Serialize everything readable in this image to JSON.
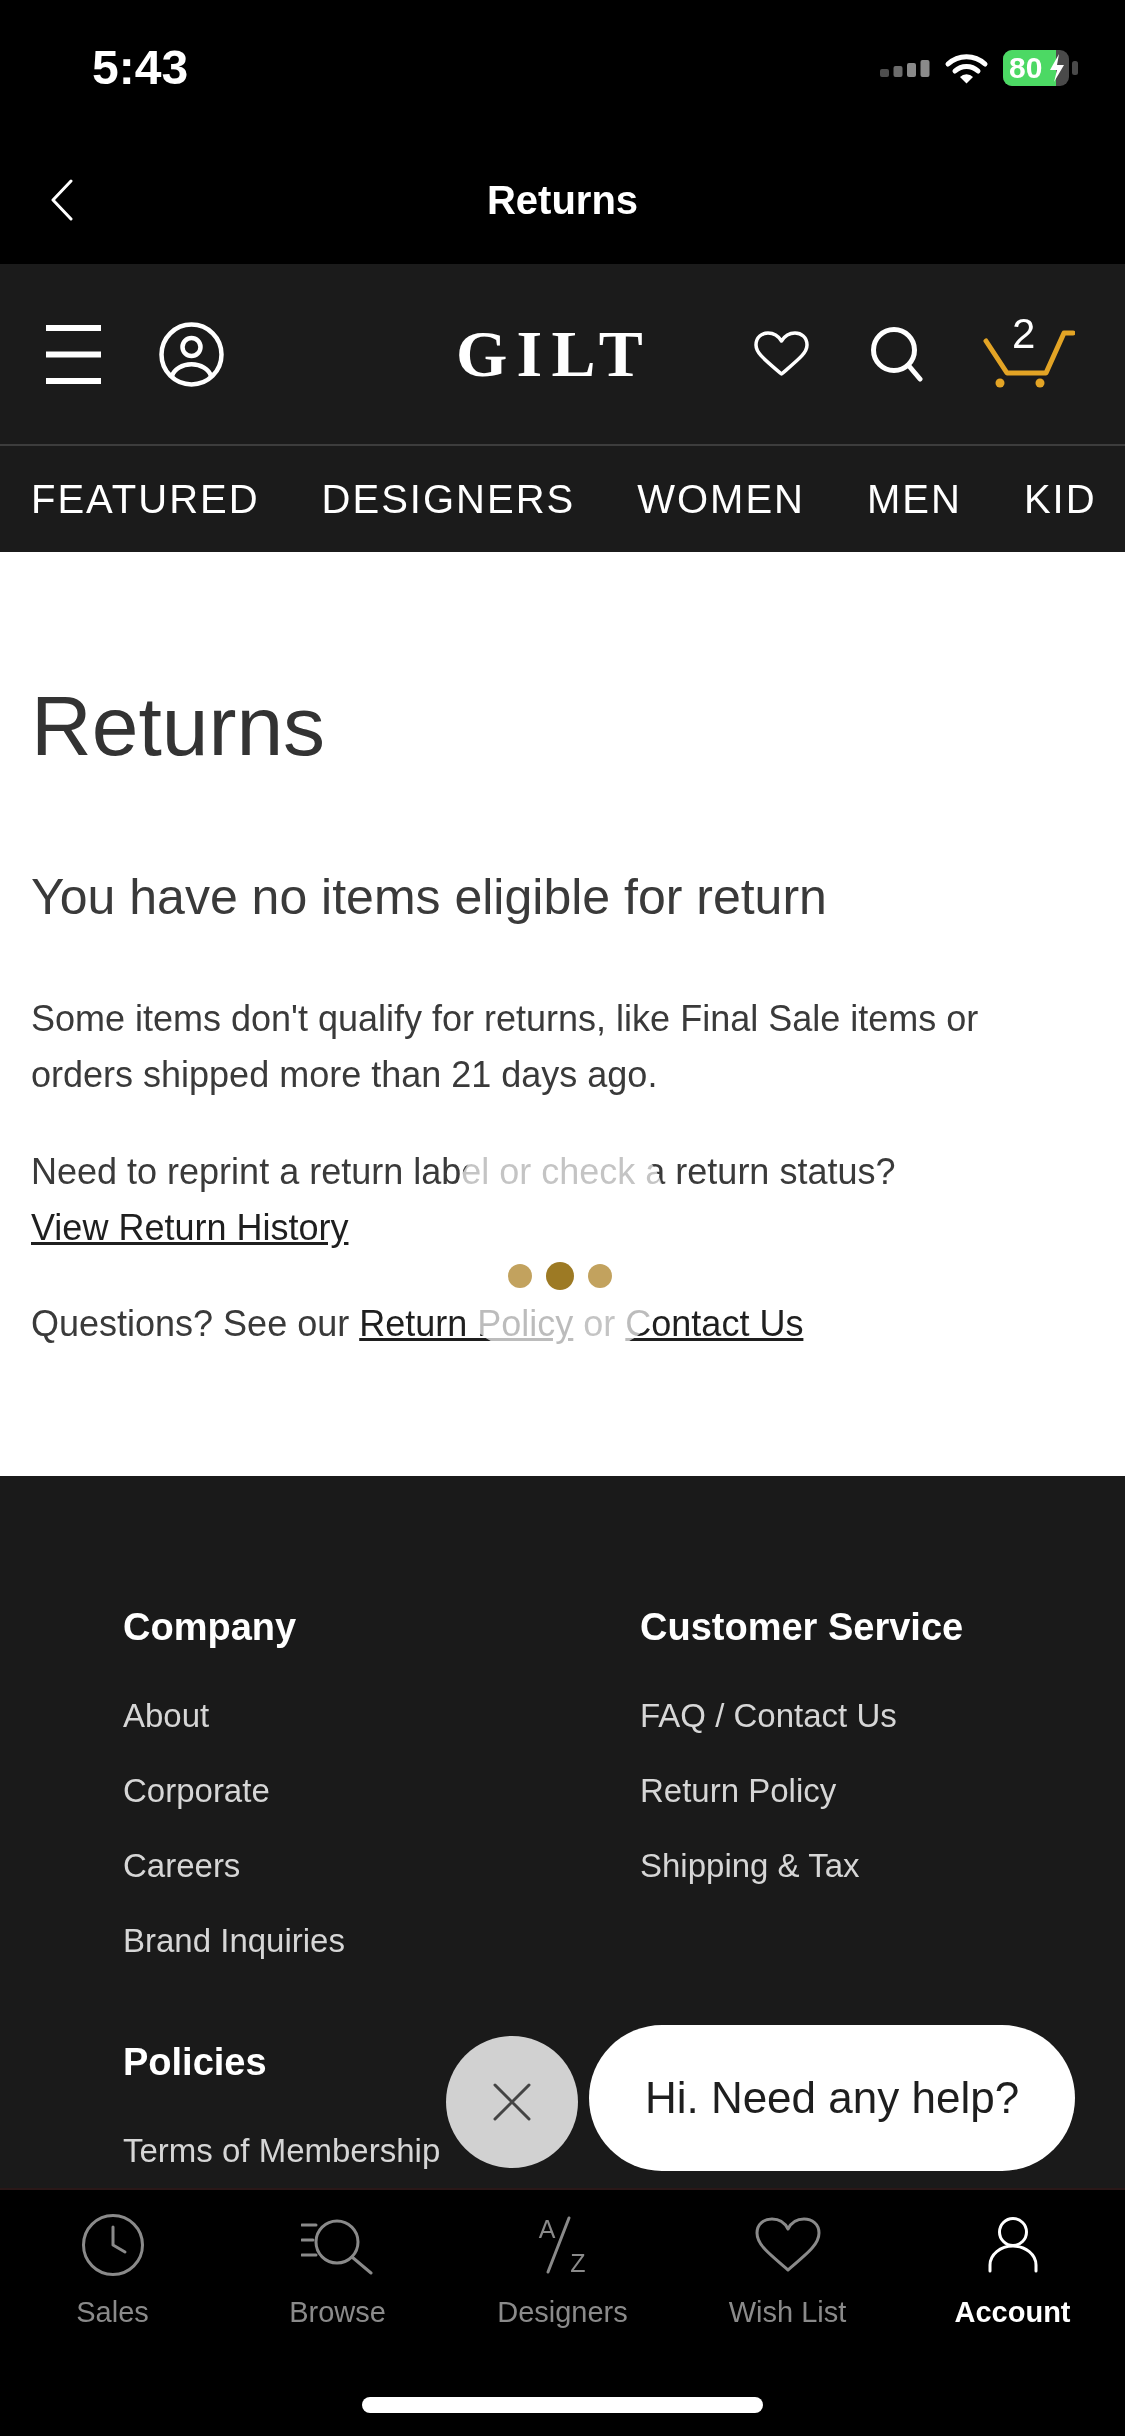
{
  "status_bar": {
    "time": "5:43",
    "battery": "80"
  },
  "nav_bar": {
    "title": "Returns"
  },
  "header": {
    "logo": "GILT",
    "cart_count": "2"
  },
  "categories": [
    "FEATURED",
    "DESIGNERS",
    "WOMEN",
    "MEN",
    "KID"
  ],
  "page": {
    "title": "Returns",
    "subtitle": "You have no items eligible for return",
    "paragraphs": [
      [
        {
          "kind": "text",
          "text": "Some items don't qualify for returns, like Final Sale items or orders shipped more than 21 days ago."
        }
      ],
      [
        {
          "kind": "text",
          "text": "Need to reprint a return label or check a return status? "
        },
        {
          "kind": "link",
          "text": "View Return History"
        }
      ],
      [
        {
          "kind": "text",
          "text": "Questions? See our "
        },
        {
          "kind": "link",
          "text": "Return Policy"
        },
        {
          "kind": "text",
          "text": " or "
        },
        {
          "kind": "link",
          "text": "Contact Us"
        }
      ]
    ],
    "loading": true
  },
  "footer": {
    "sections": [
      {
        "heading": "Company",
        "links": [
          "About",
          "Corporate",
          "Careers",
          "Brand Inquiries"
        ]
      },
      {
        "heading": "Customer Service",
        "links": [
          "FAQ / Contact Us",
          "Return Policy",
          "Shipping & Tax"
        ]
      },
      {
        "heading": "Policies",
        "links": [
          "Terms of Membership"
        ]
      }
    ]
  },
  "chat_widget": {
    "message": "Hi. Need any help?"
  },
  "tab_bar": [
    {
      "label": "Sales",
      "selected": false
    },
    {
      "label": "Browse",
      "selected": false
    },
    {
      "label": "Designers",
      "icon_letters": [
        "A",
        "Z"
      ],
      "selected": false
    },
    {
      "label": "Wish List",
      "selected": false
    },
    {
      "label": "Account",
      "selected": true
    }
  ]
}
